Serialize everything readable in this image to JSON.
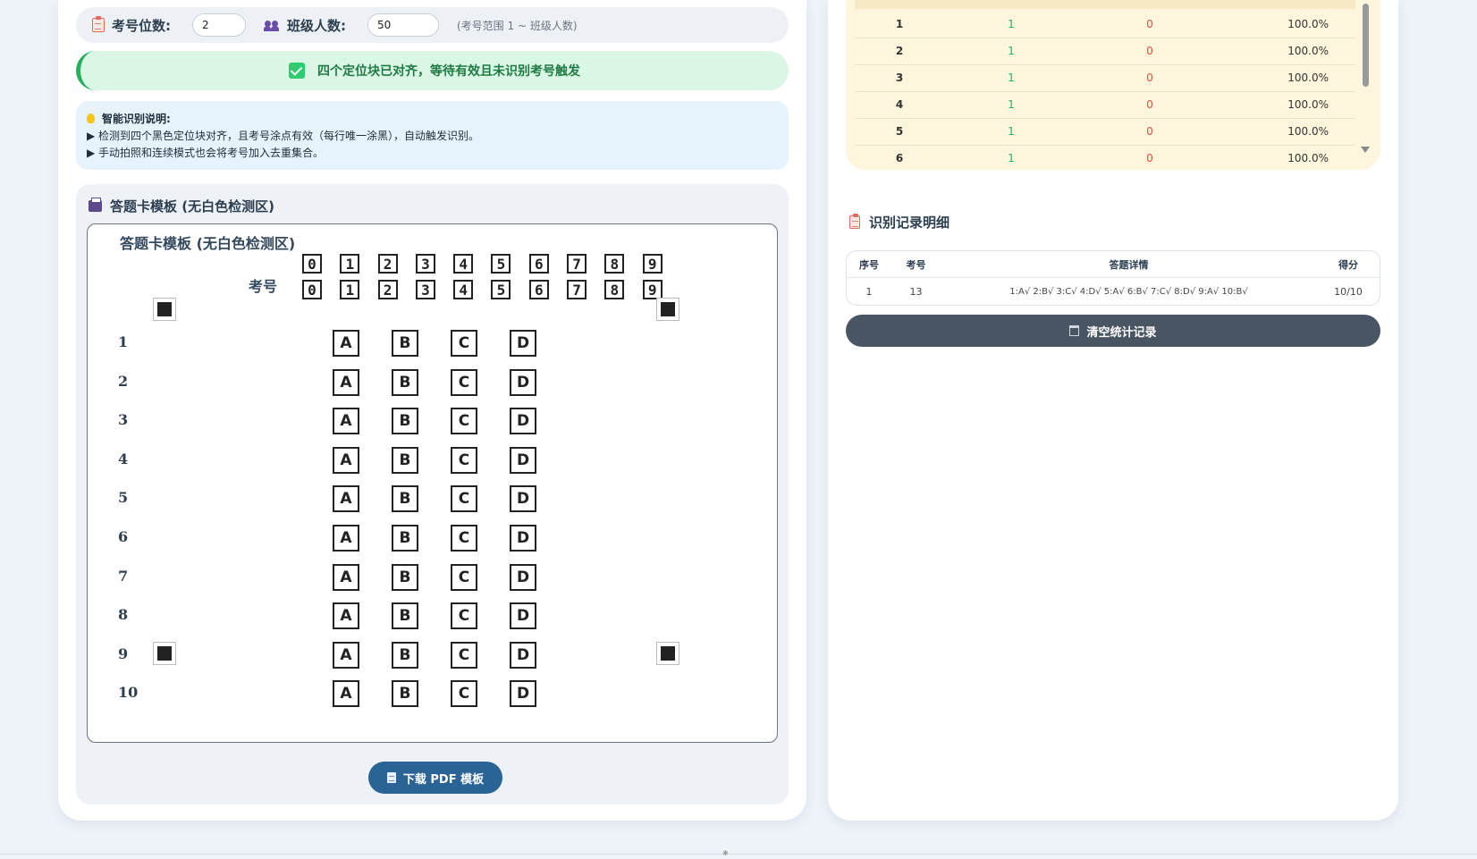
{
  "settings": {
    "id_digits_label": "考号位数:",
    "id_digits_value": "2",
    "class_size_label": "班级人数:",
    "class_size_value": "50",
    "range_note": "(考号范围 1 ~ 班级人数)"
  },
  "status": {
    "message": "四个定位块已对齐，等待有效且未识别考号触发",
    "color": "#27ae60"
  },
  "info": {
    "heading": "智能识别说明:",
    "line1": "▶ 检测到四个黑色定位块对齐，且考号涂点有效（每行唯一涂黑），自动触发识别。",
    "line2": "▶ 手动拍照和连续模式也会将考号加入去重集合。"
  },
  "template": {
    "section_title": "答题卡模板 (无白色检测区)",
    "sheet_title": "答题卡模板 (无白色检测区)",
    "id_label": "考号",
    "digits": [
      "0",
      "1",
      "2",
      "3",
      "4",
      "5",
      "6",
      "7",
      "8",
      "9"
    ],
    "options": [
      "A",
      "B",
      "C",
      "D"
    ],
    "questions": [
      "1",
      "2",
      "3",
      "4",
      "5",
      "6",
      "7",
      "8",
      "9",
      "10"
    ],
    "download_label": "下载 PDF 模板"
  },
  "stats": {
    "rows": [
      {
        "q": "1",
        "correct": "1",
        "wrong": "0",
        "rate": "100.0%"
      },
      {
        "q": "2",
        "correct": "1",
        "wrong": "0",
        "rate": "100.0%"
      },
      {
        "q": "3",
        "correct": "1",
        "wrong": "0",
        "rate": "100.0%"
      },
      {
        "q": "4",
        "correct": "1",
        "wrong": "0",
        "rate": "100.0%"
      },
      {
        "q": "5",
        "correct": "1",
        "wrong": "0",
        "rate": "100.0%"
      },
      {
        "q": "6",
        "correct": "1",
        "wrong": "0",
        "rate": "100.0%"
      }
    ]
  },
  "records": {
    "title": "识别记录明细",
    "headers": {
      "seq": "序号",
      "id": "考号",
      "detail": "答题详情",
      "score": "得分"
    },
    "rows": [
      {
        "seq": "1",
        "id": "13",
        "detail": "1:A√ 2:B√ 3:C√ 4:D√ 5:A√ 6:B√ 7:C√ 8:D√ 9:A√ 10:B√",
        "score": "10/10"
      }
    ],
    "clear_label": "清空统计记录"
  },
  "colors": {
    "accent_blue": "#2a6496",
    "success_green": "#27ae60",
    "error_red": "#e74c3c",
    "dark_button": "#4a5563"
  }
}
